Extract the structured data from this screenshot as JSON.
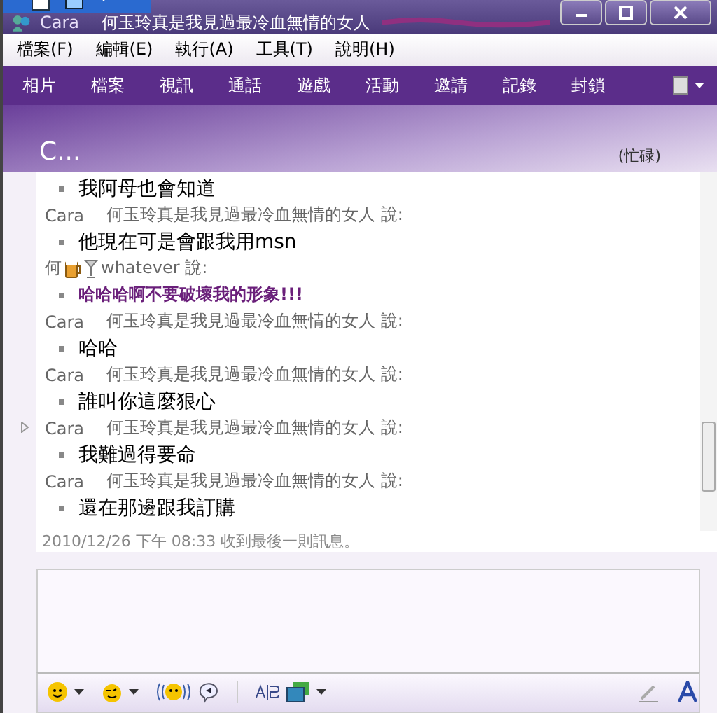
{
  "window": {
    "title_name": "Cara",
    "title_status": "何玉玲真是我見過最冷血無情的女人"
  },
  "menu": [
    "檔案(F)",
    "編輯(E)",
    "執行(A)",
    "工具(T)",
    "說明(H)"
  ],
  "toolbar": [
    "相片",
    "檔案",
    "視訊",
    "通話",
    "遊戲",
    "活動",
    "邀請",
    "記錄",
    "封鎖"
  ],
  "contact": {
    "name": "C...",
    "status": "(忙碌)"
  },
  "conversation": [
    {
      "kind": "message",
      "text": "我阿母也會知道",
      "emphasis": false
    },
    {
      "kind": "sender",
      "name": "Cara",
      "nickname": "何玉玲真是我見過最冷血無情的女人 說:"
    },
    {
      "kind": "message",
      "text": "他現在可是會跟我用msn",
      "emphasis": false
    },
    {
      "kind": "sender_icons",
      "name": "何",
      "nickname": "whatever 說:"
    },
    {
      "kind": "message",
      "text": "哈哈哈啊不要破壞我的形象!!!",
      "emphasis": true
    },
    {
      "kind": "sender",
      "name": "Cara",
      "nickname": "何玉玲真是我見過最冷血無情的女人 說:"
    },
    {
      "kind": "message",
      "text": "哈哈",
      "emphasis": false
    },
    {
      "kind": "sender",
      "name": "Cara",
      "nickname": "何玉玲真是我見過最冷血無情的女人 說:"
    },
    {
      "kind": "message",
      "text": "誰叫你這麼狠心",
      "emphasis": false
    },
    {
      "kind": "sender",
      "name": "Cara",
      "nickname": "何玉玲真是我見過最冷血無情的女人 說:"
    },
    {
      "kind": "message",
      "text": "我難過得要命",
      "emphasis": false
    },
    {
      "kind": "sender",
      "name": "Cara",
      "nickname": "何玉玲真是我見過最冷血無情的女人 說:"
    },
    {
      "kind": "message",
      "text": "還在那邊跟我訂購",
      "emphasis": false
    }
  ],
  "last_received": "2010/12/26 下午 08:33 收到最後一則訊息。"
}
